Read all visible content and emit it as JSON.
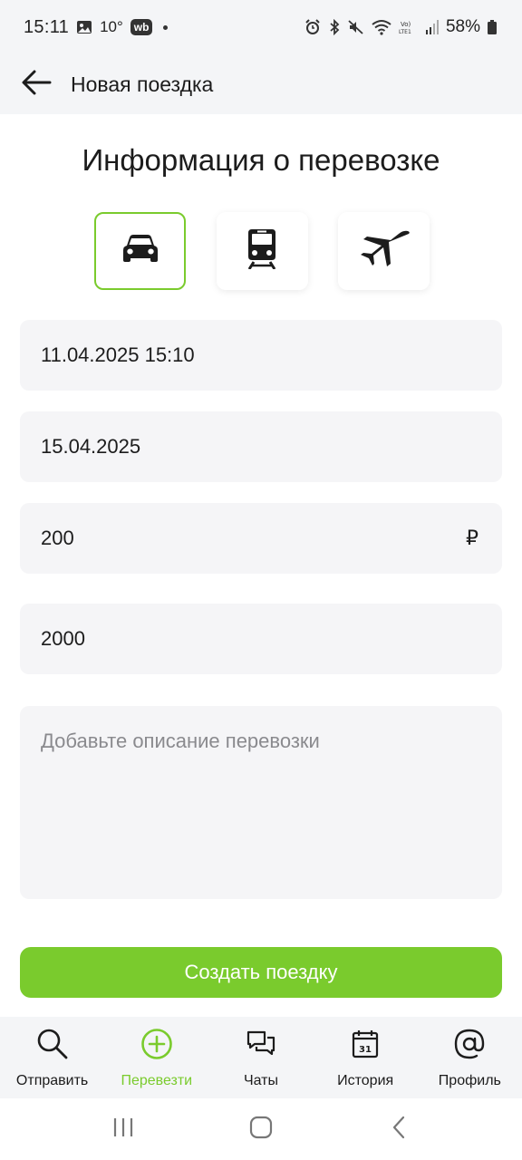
{
  "status_bar": {
    "time": "15:11",
    "temperature": "10°",
    "wb_badge": "wb",
    "battery": "58%",
    "icons": [
      "gallery-icon",
      "alarm-icon",
      "bluetooth-icon",
      "mute-icon",
      "wifi-icon",
      "volte-icon",
      "signal-icon",
      "battery-icon"
    ]
  },
  "app_bar": {
    "title": "Новая поездка"
  },
  "form": {
    "heading": "Информация о перевозке",
    "transport_options": [
      {
        "name": "car",
        "icon": "car-icon",
        "selected": true
      },
      {
        "name": "train",
        "icon": "train-icon",
        "selected": false
      },
      {
        "name": "plane",
        "icon": "airplane-icon",
        "selected": false
      }
    ],
    "departure_datetime": "11.04.2025 15:10",
    "arrival_date": "15.04.2025",
    "price": "200",
    "currency": "₽",
    "quantity": "2000",
    "description_placeholder": "Добавьте описание перевозки",
    "submit_label": "Создать поездку"
  },
  "bottom_nav": {
    "items": [
      {
        "label": "Отправить",
        "icon": "search-icon",
        "active": false
      },
      {
        "label": "Перевезти",
        "icon": "plus-circle-icon",
        "active": true
      },
      {
        "label": "Чаты",
        "icon": "chat-icon",
        "active": false
      },
      {
        "label": "История",
        "icon": "calendar-icon",
        "active": false,
        "calendar_day": "31"
      },
      {
        "label": "Профиль",
        "icon": "at-sign-icon",
        "active": false
      }
    ]
  },
  "colors": {
    "accent": "#7acb2d",
    "field_bg": "#f5f5f7",
    "bar_bg": "#f4f5f7",
    "text": "#1c1c1c",
    "placeholder": "#8a8a8e"
  }
}
